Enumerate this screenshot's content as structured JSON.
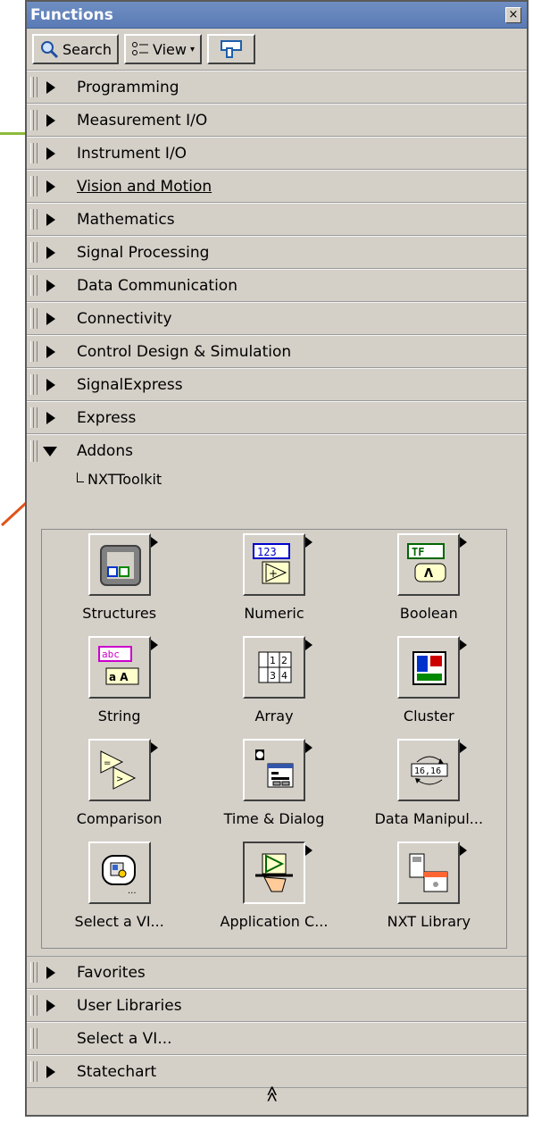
{
  "window": {
    "title": "Functions",
    "close_glyph": "×"
  },
  "toolbar": {
    "search_label": "Search",
    "view_label": "View",
    "view_dropdown_glyph": "▾"
  },
  "categories_top": [
    {
      "label": "Programming",
      "expanded": false
    },
    {
      "label": "Measurement I/O",
      "expanded": false
    },
    {
      "label": "Instrument I/O",
      "expanded": false
    },
    {
      "label": "Vision and Motion",
      "expanded": false,
      "underlined": true
    },
    {
      "label": "Mathematics",
      "expanded": false
    },
    {
      "label": "Signal Processing",
      "expanded": false
    },
    {
      "label": "Data Communication",
      "expanded": false
    },
    {
      "label": "Connectivity",
      "expanded": false
    },
    {
      "label": "Control Design & Simulation",
      "expanded": false
    },
    {
      "label": "SignalExpress",
      "expanded": false
    },
    {
      "label": "Express",
      "expanded": false
    }
  ],
  "addons": {
    "label": "Addons",
    "expanded": true,
    "child": "NXTToolkit"
  },
  "palette_items": [
    {
      "label": "Structures",
      "icon": "structures-icon"
    },
    {
      "label": "Numeric",
      "icon": "numeric-icon"
    },
    {
      "label": "Boolean",
      "icon": "boolean-icon"
    },
    {
      "label": "String",
      "icon": "string-icon"
    },
    {
      "label": "Array",
      "icon": "array-icon"
    },
    {
      "label": "Cluster",
      "icon": "cluster-icon"
    },
    {
      "label": "Comparison",
      "icon": "comparison-icon"
    },
    {
      "label": "Time & Dialog",
      "icon": "time-dialog-icon"
    },
    {
      "label": "Data Manipul...",
      "icon": "data-manipulation-icon"
    },
    {
      "label": "Select a VI...",
      "icon": "select-vi-icon"
    },
    {
      "label": "Application C...",
      "icon": "application-control-icon"
    },
    {
      "label": "NXT Library",
      "icon": "nxt-library-icon"
    }
  ],
  "icon_text": {
    "numeric": "123",
    "boolean_tf": "TF",
    "string": "abc",
    "string_sub": "a A",
    "array": "1 2 3 4",
    "data_manip": "16,16"
  },
  "categories_bottom": [
    {
      "label": "Favorites",
      "has_arrow": true
    },
    {
      "label": "User Libraries",
      "has_arrow": true
    },
    {
      "label": "Select a VI...",
      "has_arrow": false
    },
    {
      "label": "Statechart",
      "has_arrow": true
    }
  ],
  "footer": {
    "collapse_glyph": "≪"
  },
  "colors": {
    "panel_bg": "#d4d0c8",
    "titlebar": "#6384be",
    "annotation_green": "#8dbb3a",
    "annotation_orange": "#e0531a"
  }
}
